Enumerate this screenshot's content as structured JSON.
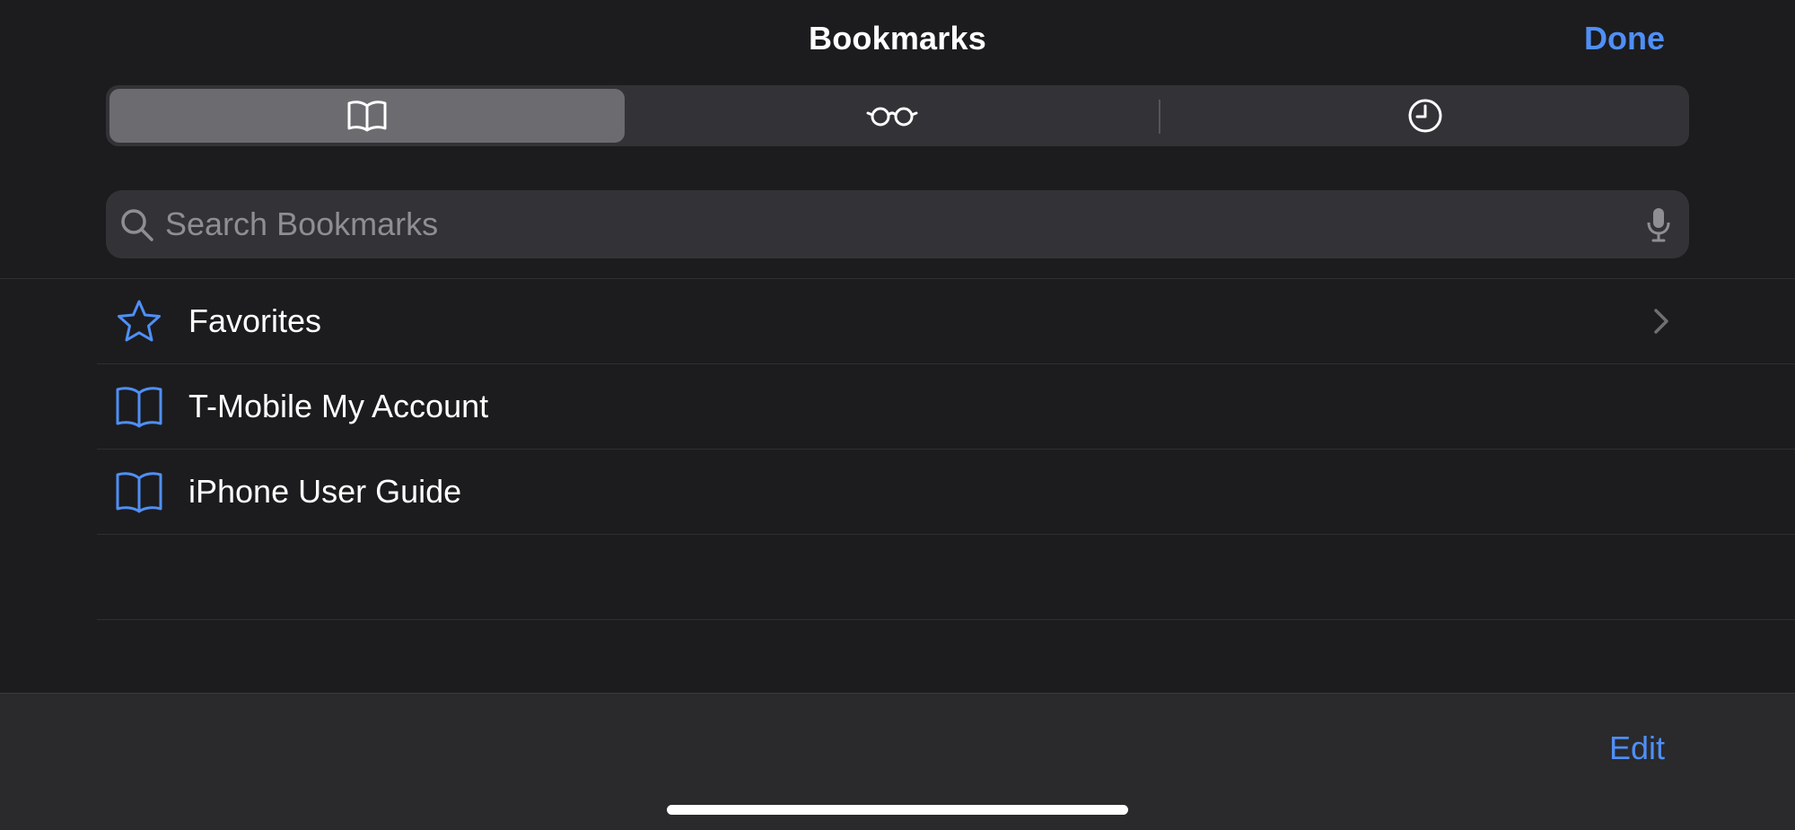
{
  "header": {
    "title": "Bookmarks",
    "done_label": "Done"
  },
  "segments": [
    {
      "icon": "book-icon",
      "selected": true
    },
    {
      "icon": "glasses-icon",
      "selected": false
    },
    {
      "icon": "clock-icon",
      "selected": false
    }
  ],
  "search": {
    "placeholder": "Search Bookmarks",
    "value": ""
  },
  "bookmarks": [
    {
      "label": "Favorites",
      "icon": "star-icon",
      "has_chevron": true
    },
    {
      "label": "T-Mobile My Account",
      "icon": "book-icon",
      "has_chevron": false
    },
    {
      "label": "iPhone User Guide",
      "icon": "book-icon",
      "has_chevron": false
    }
  ],
  "toolbar": {
    "edit_label": "Edit"
  },
  "colors": {
    "background": "#1c1c1e",
    "accent": "#4f8ff7",
    "control_fill": "#333337",
    "selected_segment": "#6c6c70",
    "toolbar": "#2a2a2c"
  }
}
